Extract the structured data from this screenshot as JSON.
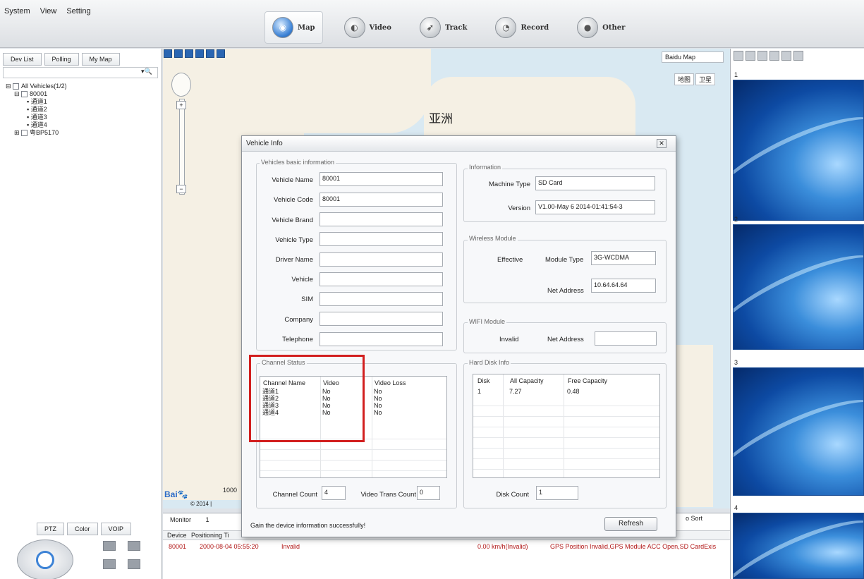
{
  "menu": [
    "System",
    "View",
    "Setting"
  ],
  "nav": [
    {
      "label": "Map",
      "icon": "globe-icon",
      "active": true
    },
    {
      "label": "Video",
      "icon": "video-icon",
      "active": false
    },
    {
      "label": "Track",
      "icon": "track-icon",
      "active": false
    },
    {
      "label": "Record",
      "icon": "record-icon",
      "active": false
    },
    {
      "label": "Other",
      "icon": "other-icon",
      "active": false
    }
  ],
  "left_tabs": [
    "Dev List",
    "Polling",
    "My Map"
  ],
  "tree": {
    "root": "All Vehicles(1/2)",
    "vehicle1": "80001",
    "channels": [
      "通道1",
      "通道2",
      "通道3",
      "通道4"
    ],
    "vehicle2": "粤BP5170"
  },
  "bottom_tabs": [
    "PTZ",
    "Color",
    "VOIP"
  ],
  "map": {
    "type_select": "Baidu Map",
    "view_buttons": [
      "地图",
      "卫星"
    ],
    "label": "亚洲",
    "scale": "1000",
    "copyright": "© 2014 |"
  },
  "monitor": {
    "label": "Monitor",
    "count": "1",
    "sort": "o Sort",
    "headers": [
      "Device",
      "Positioning Ti"
    ],
    "row": {
      "device": "80001",
      "time": "2000-08-04 05:55:20",
      "status": "Invalid",
      "speed": "0.00 km/h(Invalid)",
      "alarm": "GPS Position Invalid,GPS Module  ACC Open,SD CardExis"
    }
  },
  "video_numbers": [
    "1",
    "2",
    "3",
    "4"
  ],
  "dialog": {
    "title": "Vehicle Info",
    "basic": {
      "legend": "Vehicles basic information",
      "fields": [
        {
          "label": "Vehicle Name",
          "value": "80001"
        },
        {
          "label": "Vehicle Code",
          "value": "80001"
        },
        {
          "label": "Vehicle Brand",
          "value": ""
        },
        {
          "label": "Vehicle Type",
          "value": ""
        },
        {
          "label": "Driver Name",
          "value": ""
        },
        {
          "label": "Vehicle",
          "value": ""
        },
        {
          "label": "SIM",
          "value": ""
        },
        {
          "label": "Company",
          "value": ""
        },
        {
          "label": "Telephone",
          "value": ""
        }
      ]
    },
    "info": {
      "legend": "Information",
      "machine_type_label": "Machine Type",
      "machine_type": "SD Card",
      "version_label": "Version",
      "version": "V1.00-May  6 2014-01:41:54-3"
    },
    "wireless": {
      "legend": "Wireless Module",
      "status": "Effective",
      "module_type_label": "Module Type",
      "module_type": "3G-WCDMA",
      "net_address_label": "Net Address",
      "net_address": "10.64.64.64"
    },
    "wifi": {
      "legend": "WIFI Module",
      "status": "Invalid",
      "net_address_label": "Net Address",
      "net_address": ""
    },
    "channel": {
      "legend": "Channel Status",
      "headers": [
        "Channel Name",
        "Video",
        "Video Loss"
      ],
      "rows": [
        [
          "通道1",
          "No",
          "No"
        ],
        [
          "通道2",
          "No",
          "No"
        ],
        [
          "通道3",
          "No",
          "No"
        ],
        [
          "通道4",
          "No",
          "No"
        ]
      ],
      "channel_count_label": "Channel Count",
      "channel_count": "4",
      "trans_count_label": "Video Trans Count",
      "trans_count": "0"
    },
    "disk": {
      "legend": "Hard Disk Info",
      "headers": [
        "Disk",
        "All Capacity",
        "Free Capacity"
      ],
      "rows": [
        [
          "1",
          "7.27",
          "0.48"
        ]
      ],
      "disk_count_label": "Disk Count",
      "disk_count": "1"
    },
    "status_message": "Gain the device information successfully!",
    "refresh_label": "Refresh"
  },
  "colors": {
    "highlight_box": "#d21f1f",
    "alarm_text": "#b21818",
    "accent": "#3d83d6"
  }
}
